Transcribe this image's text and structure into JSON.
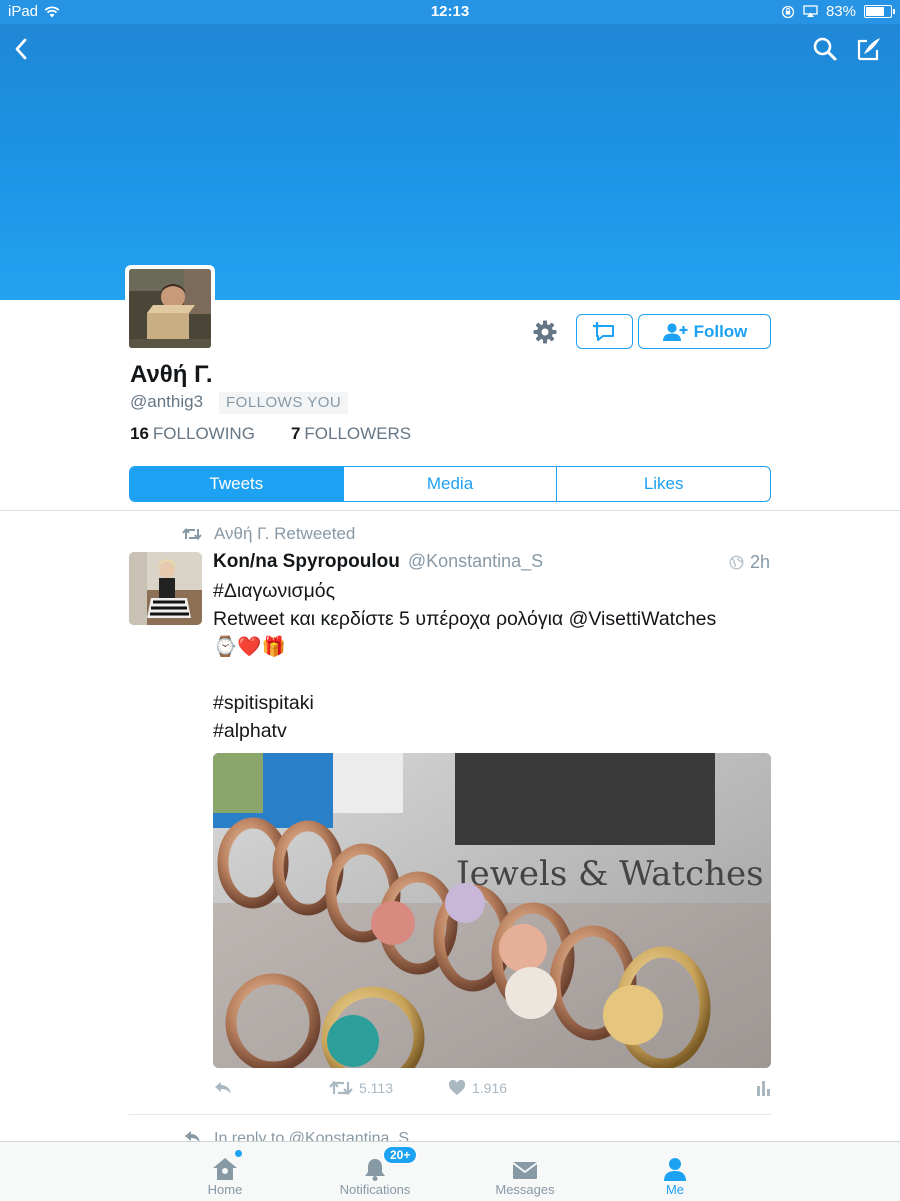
{
  "status_bar": {
    "device": "iPad",
    "time": "12:13",
    "battery": "83%",
    "battery_level": 0.83
  },
  "profile": {
    "name": "Ανθή Γ.",
    "handle": "@anthig3",
    "follows_you": "FOLLOWS YOU",
    "following_count": "16",
    "following_label": "FOLLOWING",
    "followers_count": "7",
    "followers_label": "FOLLOWERS",
    "follow_label": "Follow"
  },
  "tabs": [
    {
      "label": "Tweets",
      "active": true
    },
    {
      "label": "Media",
      "active": false
    },
    {
      "label": "Likes",
      "active": false
    }
  ],
  "tweet": {
    "retweeted_by": "Ανθή Γ. Retweeted",
    "author": "Kon/na Spyropoulou",
    "handle": "@Konstantina_S",
    "time": "2h",
    "lines": [
      "#Διαγωνισμός",
      "Retweet και κερδίστε 5 υπέροχα ρολόγια @VisettiWatches",
      "⌚❤️🎁",
      "",
      "#spitispitaki",
      "#alphatv"
    ],
    "media_text": "Jewels & Watches",
    "retweets": "5.113",
    "likes": "1.916"
  },
  "next_tweet": {
    "reply_to": "In reply to @Konstantina_S"
  },
  "tab_bar": {
    "items": [
      {
        "label": "Home"
      },
      {
        "label": "Notifications",
        "badge": "20+"
      },
      {
        "label": "Messages"
      },
      {
        "label": "Me"
      }
    ]
  },
  "colors": {
    "accent": "#1da1f2",
    "banner": "#1d95e6"
  }
}
